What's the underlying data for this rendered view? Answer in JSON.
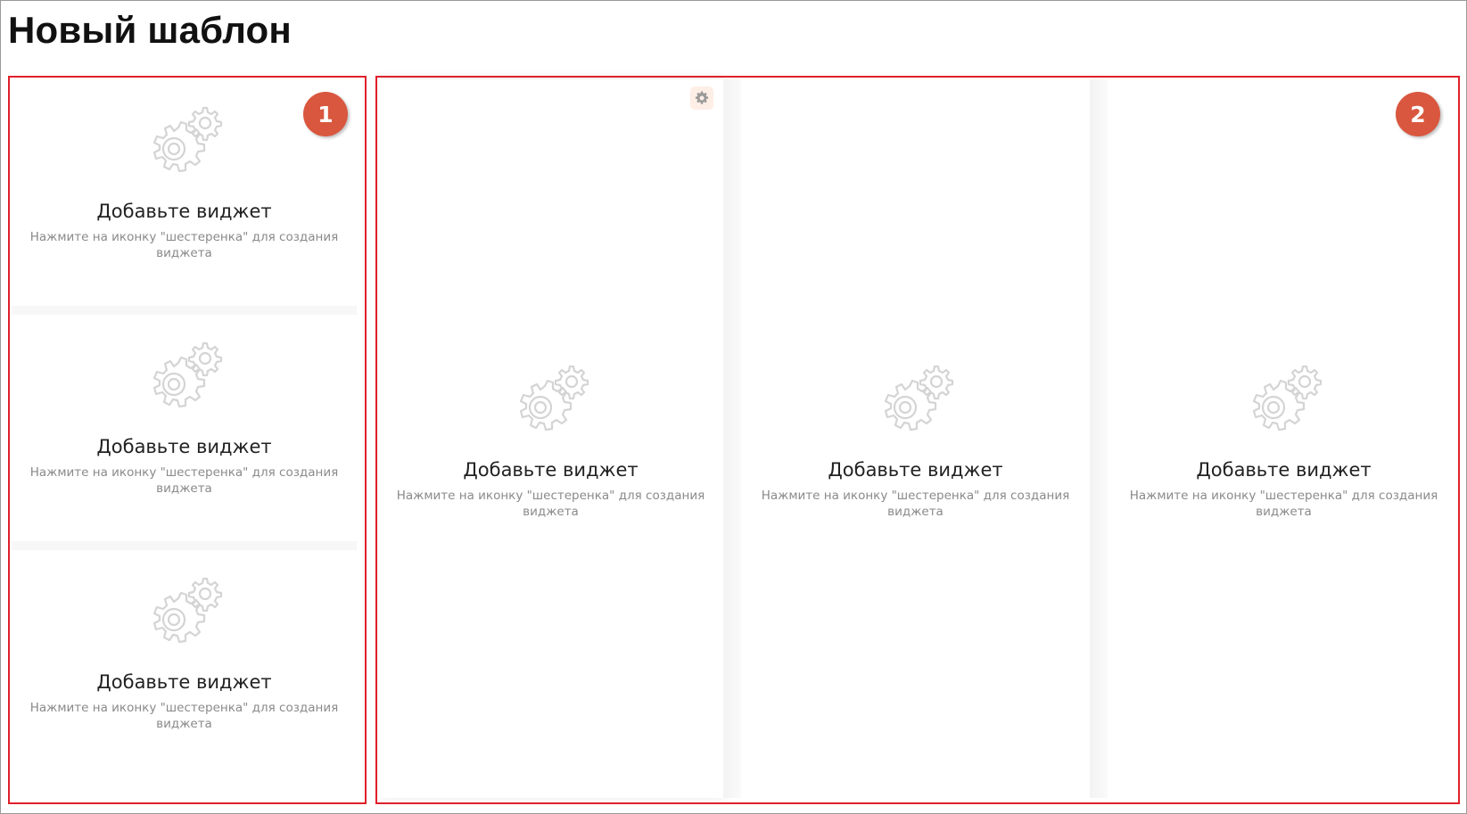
{
  "page": {
    "title": "Новый шаблон"
  },
  "widget_placeholder": {
    "title": "Добавьте виджет",
    "hint": "Нажмите на иконку \"шестеренка\" для создания виджета",
    "icon": "gears-icon"
  },
  "left_column": {
    "widgets": [
      {
        "title": "Добавьте виджет",
        "hint": "Нажмите на иконку \"шестеренка\" для создания виджета"
      },
      {
        "title": "Добавьте виджет",
        "hint": "Нажмите на иконку \"шестеренка\" для создания виджета"
      },
      {
        "title": "Добавьте виджет",
        "hint": "Нажмите на иконку \"шестеренка\" для создания виджета"
      }
    ]
  },
  "right_area": {
    "widgets": [
      {
        "title": "Добавьте виджет",
        "hint": "Нажмите на иконку \"шестеренка\" для создания виджета",
        "settings_icon": "gear-icon"
      },
      {
        "title": "Добавьте виджет",
        "hint": "Нажмите на иконку \"шестеренка\" для создания виджета"
      },
      {
        "title": "Добавьте виджет",
        "hint": "Нажмите на иконку \"шестеренка\" для создания виджета"
      }
    ]
  },
  "annotations": [
    {
      "label": "1"
    },
    {
      "label": "2"
    }
  ],
  "colors": {
    "highlight": "#e0202a",
    "badge": "#d9573f",
    "icon_stroke": "#d6d6d6"
  }
}
